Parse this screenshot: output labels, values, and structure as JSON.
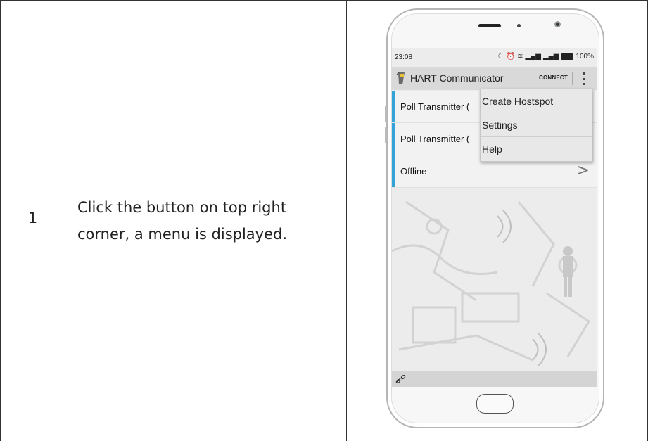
{
  "table": {
    "step_number": "1",
    "instruction": "Click the button on top right corner, a menu is displayed."
  },
  "phone": {
    "status_bar": {
      "time": "23:08",
      "battery": "100%"
    },
    "app_bar": {
      "title": "HART Communicator",
      "connect_label": "CONNECT",
      "app_icon": "hart-device-icon",
      "overflow_icon": "more-vert-icon"
    },
    "list": [
      {
        "label": "Poll Transmitter ("
      },
      {
        "label": "Poll Transmitter ("
      },
      {
        "label": "Offline",
        "chevron": ">"
      }
    ],
    "menu": {
      "items": [
        "Create Hostspot",
        "Settings",
        "Help"
      ]
    },
    "bottom_bar": {
      "icon": "link-icon"
    },
    "accent_color": "#33a3d9"
  }
}
